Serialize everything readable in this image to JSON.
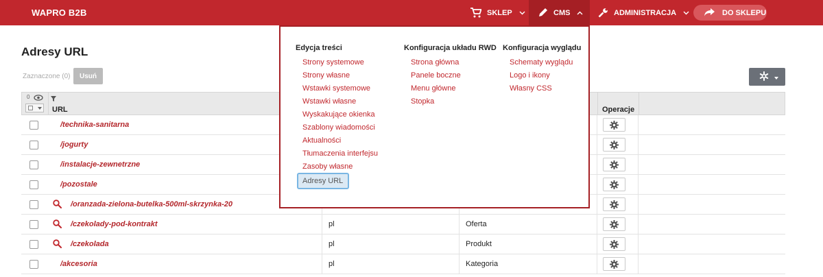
{
  "topbar": {
    "brand": "WAPRO B2B",
    "nav": [
      {
        "label": "SKLEP",
        "icon": "cart-icon"
      },
      {
        "label": "CMS",
        "icon": "pencil-icon"
      },
      {
        "label": "ADMINISTRACJA",
        "icon": "wrench-icon"
      }
    ],
    "shop_button": "DO SKLEPU",
    "colors": {
      "bar": "#c1272d",
      "active": "#a51f24",
      "button": "#d9575c"
    }
  },
  "page": {
    "title": "Adresy URL",
    "selected_label": "Zaznaczone (0)",
    "delete_label": "Usuń"
  },
  "grid": {
    "visible_count": "0",
    "columns": {
      "url": "URL",
      "operations": "Operacje"
    },
    "rows": [
      {
        "url": "/technika-sanitarna",
        "search": false,
        "lang": "",
        "type": ""
      },
      {
        "url": "/jogurty",
        "search": false,
        "lang": "",
        "type": ""
      },
      {
        "url": "/instalacje-zewnetrzne",
        "search": false,
        "lang": "",
        "type": ""
      },
      {
        "url": "/pozostale",
        "search": false,
        "lang": "",
        "type": ""
      },
      {
        "url": "/oranzada-zielona-butelka-500ml-skrzynka-20",
        "search": true,
        "lang": "",
        "type": ""
      },
      {
        "url": "/czekolady-pod-kontrakt",
        "search": true,
        "lang": "pl",
        "type": "Oferta"
      },
      {
        "url": "/czekolada",
        "search": true,
        "lang": "pl",
        "type": "Produkt"
      },
      {
        "url": "/akcesoria",
        "search": false,
        "lang": "pl",
        "type": "Kategoria"
      }
    ]
  },
  "cms_menu": {
    "columns": [
      {
        "heading": "Edycja treści",
        "items": [
          "Strony systemowe",
          "Strony własne",
          "Wstawki systemowe",
          "Wstawki własne",
          "Wyskakujące okienka",
          "Szablony wiadomości",
          "Aktualności",
          "Tłumaczenia interfejsu",
          "Zasoby własne",
          "Adresy URL"
        ],
        "active": "Adresy URL"
      },
      {
        "heading": "Konfiguracja układu RWD",
        "items": [
          "Strona główna",
          "Panele boczne",
          "Menu główne",
          "Stopka"
        ]
      },
      {
        "heading": "Konfiguracja wyglądu",
        "items": [
          "Schematy wyglądu",
          "Logo i ikony",
          "Własny CSS"
        ]
      }
    ]
  }
}
